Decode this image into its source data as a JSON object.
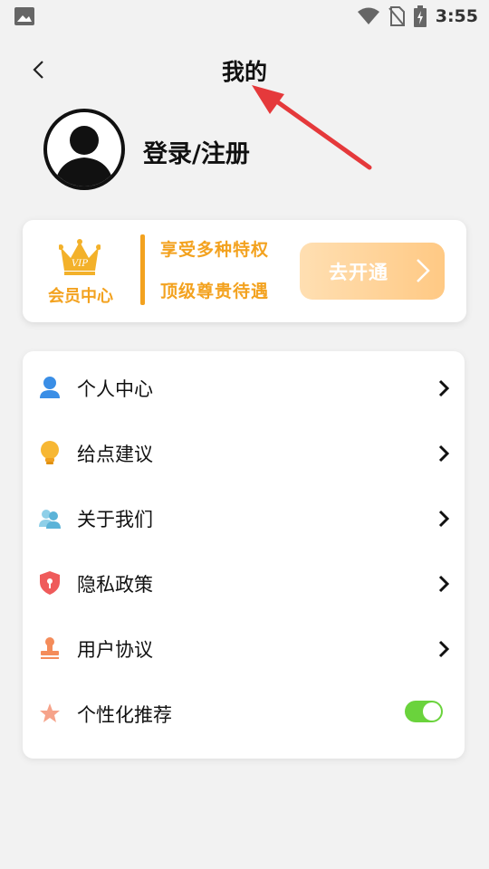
{
  "status_bar": {
    "time": "3:55",
    "icons": [
      "image-icon",
      "wifi-icon",
      "no-sim-icon",
      "battery-charging-icon"
    ]
  },
  "header": {
    "title": "我的",
    "back_icon": "chevron-left-icon"
  },
  "profile": {
    "avatar_icon": "user-avatar-icon",
    "login_label": "登录/注册"
  },
  "vip": {
    "badge_text": "VIP",
    "label": "会员中心",
    "line1": "享受多种特权",
    "line2": "顶级尊贵待遇",
    "button_label": "去开通",
    "accent_color": "#f3a21f"
  },
  "menu": {
    "items": [
      {
        "label": "个人中心",
        "icon": "person-icon"
      },
      {
        "label": "给点建议",
        "icon": "lightbulb-icon"
      },
      {
        "label": "关于我们",
        "icon": "group-icon"
      },
      {
        "label": "隐私政策",
        "icon": "shield-icon"
      },
      {
        "label": "用户协议",
        "icon": "stamp-icon"
      },
      {
        "label": "个性化推荐",
        "icon": "star-icon",
        "toggle": true,
        "toggle_on": true
      }
    ],
    "toggle_color": "#6ad33c"
  },
  "annotation": {
    "arrow_color": "#e5393b",
    "arrow_icon": "red-arrow-annotation"
  }
}
